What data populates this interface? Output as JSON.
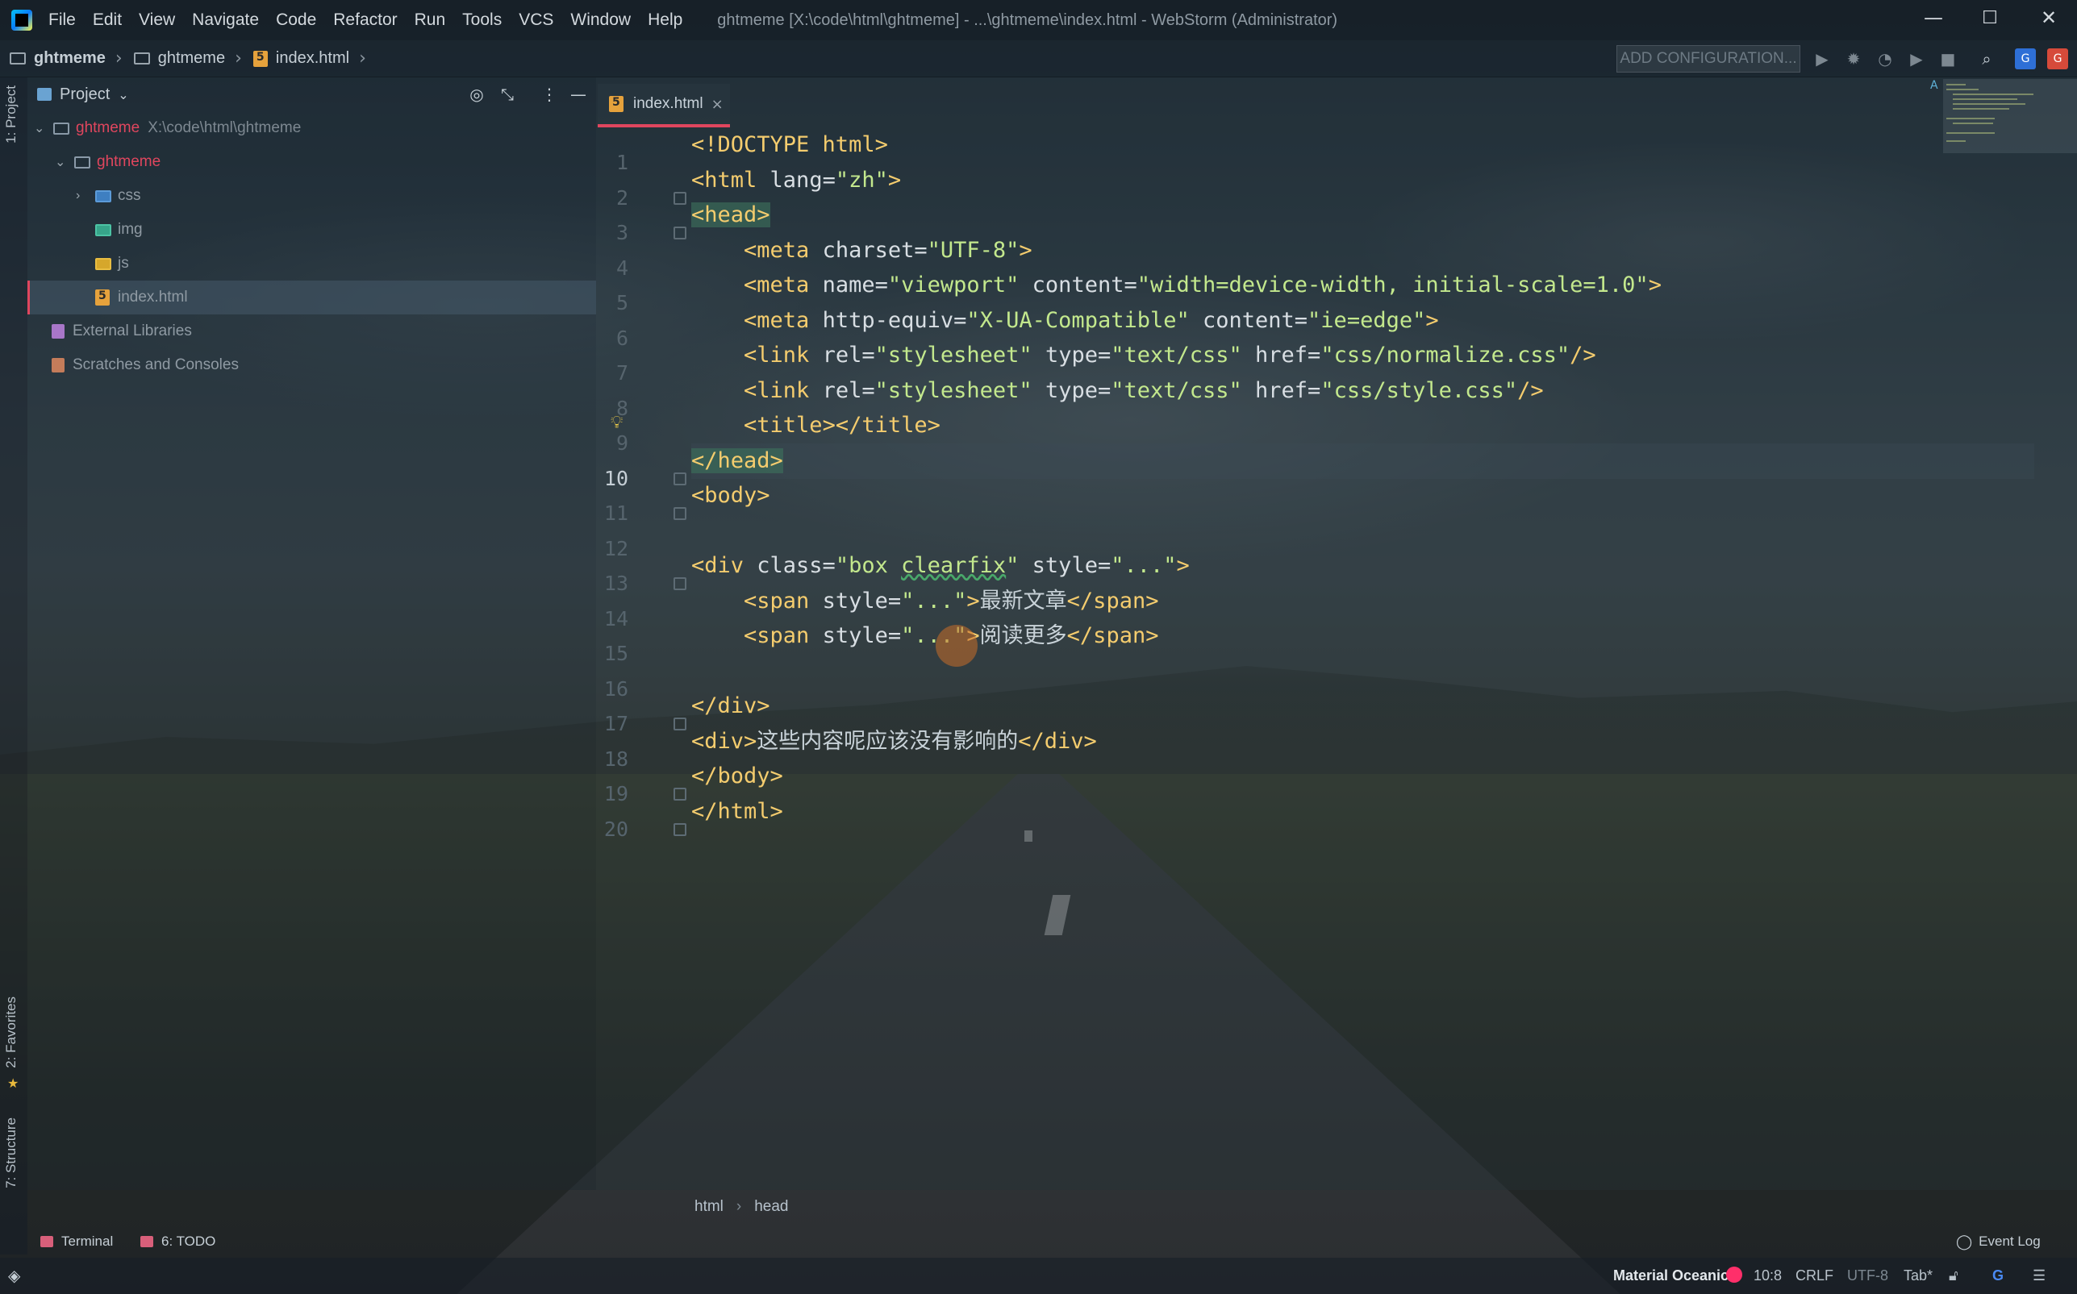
{
  "titlebar": {
    "menus": [
      "File",
      "Edit",
      "View",
      "Navigate",
      "Code",
      "Refactor",
      "Run",
      "Tools",
      "VCS",
      "Window",
      "Help"
    ],
    "window_title": "ghtmeme [X:\\code\\html\\ghtmeme] - ...\\ghtmeme\\index.html - WebStorm (Administrator)",
    "controls": {
      "minimize": "—",
      "maximize": "☐",
      "close": "✕"
    }
  },
  "navbar": {
    "crumbs": [
      "ghtmeme",
      "ghtmeme",
      "index.html"
    ],
    "add_configuration": "ADD CONFIGURATION..."
  },
  "left_stripe": {
    "project_tab": "1: Project",
    "favorites_tab": "2: Favorites",
    "structure_tab": "7: Structure"
  },
  "project_panel": {
    "title": "Project",
    "root_name": "ghtmeme",
    "root_path": "X:\\code\\html\\ghtmeme",
    "tree": [
      {
        "label": "ghtmeme",
        "kind": "folder"
      },
      {
        "label": "css",
        "kind": "folder-blue"
      },
      {
        "label": "img",
        "kind": "folder-teal"
      },
      {
        "label": "js",
        "kind": "folder-yellow"
      },
      {
        "label": "index.html",
        "kind": "html"
      },
      {
        "label": "External Libraries",
        "kind": "library"
      },
      {
        "label": "Scratches and Consoles",
        "kind": "scratch"
      }
    ]
  },
  "editor": {
    "tab_label": "index.html",
    "line_numbers": [
      "1",
      "2",
      "3",
      "4",
      "5",
      "6",
      "7",
      "8",
      "9",
      "10",
      "11",
      "12",
      "13",
      "14",
      "15",
      "16",
      "17",
      "18",
      "19",
      "20"
    ],
    "current_line": 10,
    "breadcrumb": [
      "html",
      "head"
    ],
    "lines": [
      {
        "p": [
          [
            "tag",
            "<!DOCTYPE html>"
          ]
        ]
      },
      {
        "p": [
          [
            "tag",
            "<html "
          ],
          [
            "attr",
            "lang="
          ],
          [
            "str",
            "\"zh\""
          ],
          [
            "tag",
            ">"
          ]
        ]
      },
      {
        "p": [
          [
            "taghl",
            "<head>"
          ]
        ]
      },
      {
        "p": [
          [
            "txt",
            "    "
          ],
          [
            "tag",
            "<meta "
          ],
          [
            "attr",
            "charset="
          ],
          [
            "str",
            "\"UTF-8\""
          ],
          [
            "tag",
            ">"
          ]
        ]
      },
      {
        "p": [
          [
            "txt",
            "    "
          ],
          [
            "tag",
            "<meta "
          ],
          [
            "attr",
            "name="
          ],
          [
            "str",
            "\"viewport\" "
          ],
          [
            "attr",
            "content="
          ],
          [
            "str",
            "\"width=device-width, initial-scale=1.0\""
          ],
          [
            "tag",
            ">"
          ]
        ]
      },
      {
        "p": [
          [
            "txt",
            "    "
          ],
          [
            "tag",
            "<meta "
          ],
          [
            "attr",
            "http-equiv="
          ],
          [
            "str",
            "\"X-UA-Compatible\" "
          ],
          [
            "attr",
            "content="
          ],
          [
            "str",
            "\"ie=edge\""
          ],
          [
            "tag",
            ">"
          ]
        ]
      },
      {
        "p": [
          [
            "txt",
            "    "
          ],
          [
            "tag",
            "<link "
          ],
          [
            "attr",
            "rel="
          ],
          [
            "str",
            "\"stylesheet\" "
          ],
          [
            "attr",
            "type="
          ],
          [
            "str",
            "\"text/css\" "
          ],
          [
            "attr",
            "href="
          ],
          [
            "str",
            "\"css/normalize.css\""
          ],
          [
            "tag",
            "/>"
          ]
        ]
      },
      {
        "p": [
          [
            "txt",
            "    "
          ],
          [
            "tag",
            "<link "
          ],
          [
            "attr",
            "rel="
          ],
          [
            "str",
            "\"stylesheet\" "
          ],
          [
            "attr",
            "type="
          ],
          [
            "str",
            "\"text/css\" "
          ],
          [
            "attr",
            "href="
          ],
          [
            "str",
            "\"css/style.css\""
          ],
          [
            "tag",
            "/>"
          ]
        ]
      },
      {
        "p": [
          [
            "txt",
            "    "
          ],
          [
            "tag",
            "<title></title>"
          ]
        ]
      },
      {
        "p": [
          [
            "taghl",
            "</head>"
          ]
        ]
      },
      {
        "p": [
          [
            "tag",
            "<body>"
          ]
        ]
      },
      {
        "p": []
      },
      {
        "p": [
          [
            "tag",
            "<div "
          ],
          [
            "attr",
            "class="
          ],
          [
            "str",
            "\"box "
          ],
          [
            "squig",
            "clearfix"
          ],
          [
            "str",
            "\" "
          ],
          [
            "attr",
            "style="
          ],
          [
            "str",
            "\"...\""
          ],
          [
            "tag",
            ">"
          ]
        ]
      },
      {
        "p": [
          [
            "txt",
            "    "
          ],
          [
            "tag",
            "<span "
          ],
          [
            "attr",
            "style="
          ],
          [
            "str",
            "\"...\""
          ],
          [
            "tag",
            ">"
          ],
          [
            "txt",
            "最新文章"
          ],
          [
            "tag",
            "</span>"
          ]
        ]
      },
      {
        "p": [
          [
            "txt",
            "    "
          ],
          [
            "tag",
            "<span "
          ],
          [
            "attr",
            "style="
          ],
          [
            "str",
            "\"...\""
          ],
          [
            "tag",
            ">"
          ],
          [
            "txt",
            "阅读更多"
          ],
          [
            "tag",
            "</span>"
          ]
        ]
      },
      {
        "p": []
      },
      {
        "p": [
          [
            "tag",
            "</div>"
          ]
        ]
      },
      {
        "p": [
          [
            "tag",
            "<div>"
          ],
          [
            "txt",
            "这些内容呢应该没有影响的"
          ],
          [
            "tag",
            "</div>"
          ]
        ]
      },
      {
        "p": [
          [
            "tag",
            "</body>"
          ]
        ]
      },
      {
        "p": [
          [
            "tag",
            "</html>"
          ]
        ]
      }
    ]
  },
  "bottom_tools": {
    "terminal": "Terminal",
    "todo": "6: TODO",
    "event_log": "Event Log"
  },
  "statusbar": {
    "theme": "Material Oceanic",
    "position": "10:8",
    "line_sep": "CRLF",
    "encoding": "UTF-8",
    "indent": "Tab*"
  },
  "colors": {
    "accent": "#e0465e",
    "tag": "#f4cc6e",
    "string": "#c3e88d",
    "attribute": "#d8dee3"
  }
}
